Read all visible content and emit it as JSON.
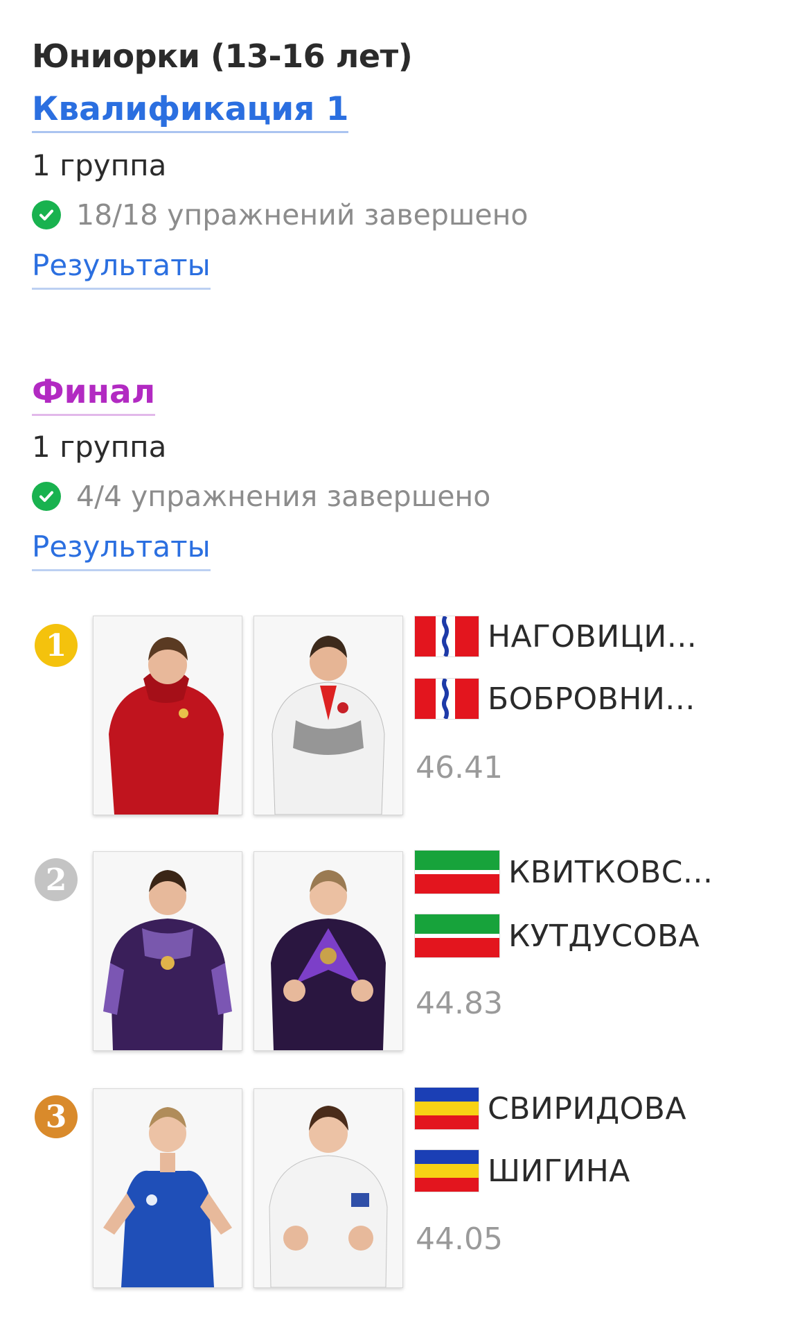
{
  "category_title": "Юниорки (13-16 лет)",
  "qualification": {
    "title": "Квалификация 1",
    "group": "1 группа",
    "status": "18/18 упражнений завершено",
    "results_link": "Результаты"
  },
  "final": {
    "title": "Финал",
    "group": "1 группа",
    "status": "4/4 упражнения завершено",
    "results_link": "Результаты"
  },
  "podium": [
    {
      "place": "1",
      "medal_color": "#f4c20d",
      "athletes": [
        {
          "name": "НАГОВИЦИ...",
          "flag": "flag-red-white-blue-wave-icon"
        },
        {
          "name": "БОБРОВНИ...",
          "flag": "flag-red-white-blue-wave-icon"
        }
      ],
      "score": "46.41"
    },
    {
      "place": "2",
      "medal_color": "#c4c4c4",
      "athletes": [
        {
          "name": "КВИТКОВС...",
          "flag": "flag-tatarstan-icon"
        },
        {
          "name": "КУТДУСОВА",
          "flag": "flag-tatarstan-icon"
        }
      ],
      "score": "44.83"
    },
    {
      "place": "3",
      "medal_color": "#d98a2b",
      "athletes": [
        {
          "name": "СВИРИДОВА",
          "flag": "flag-blue-yellow-red-icon"
        },
        {
          "name": "ШИГИНА",
          "flag": "flag-blue-yellow-red-icon"
        }
      ],
      "score": "44.05"
    }
  ]
}
